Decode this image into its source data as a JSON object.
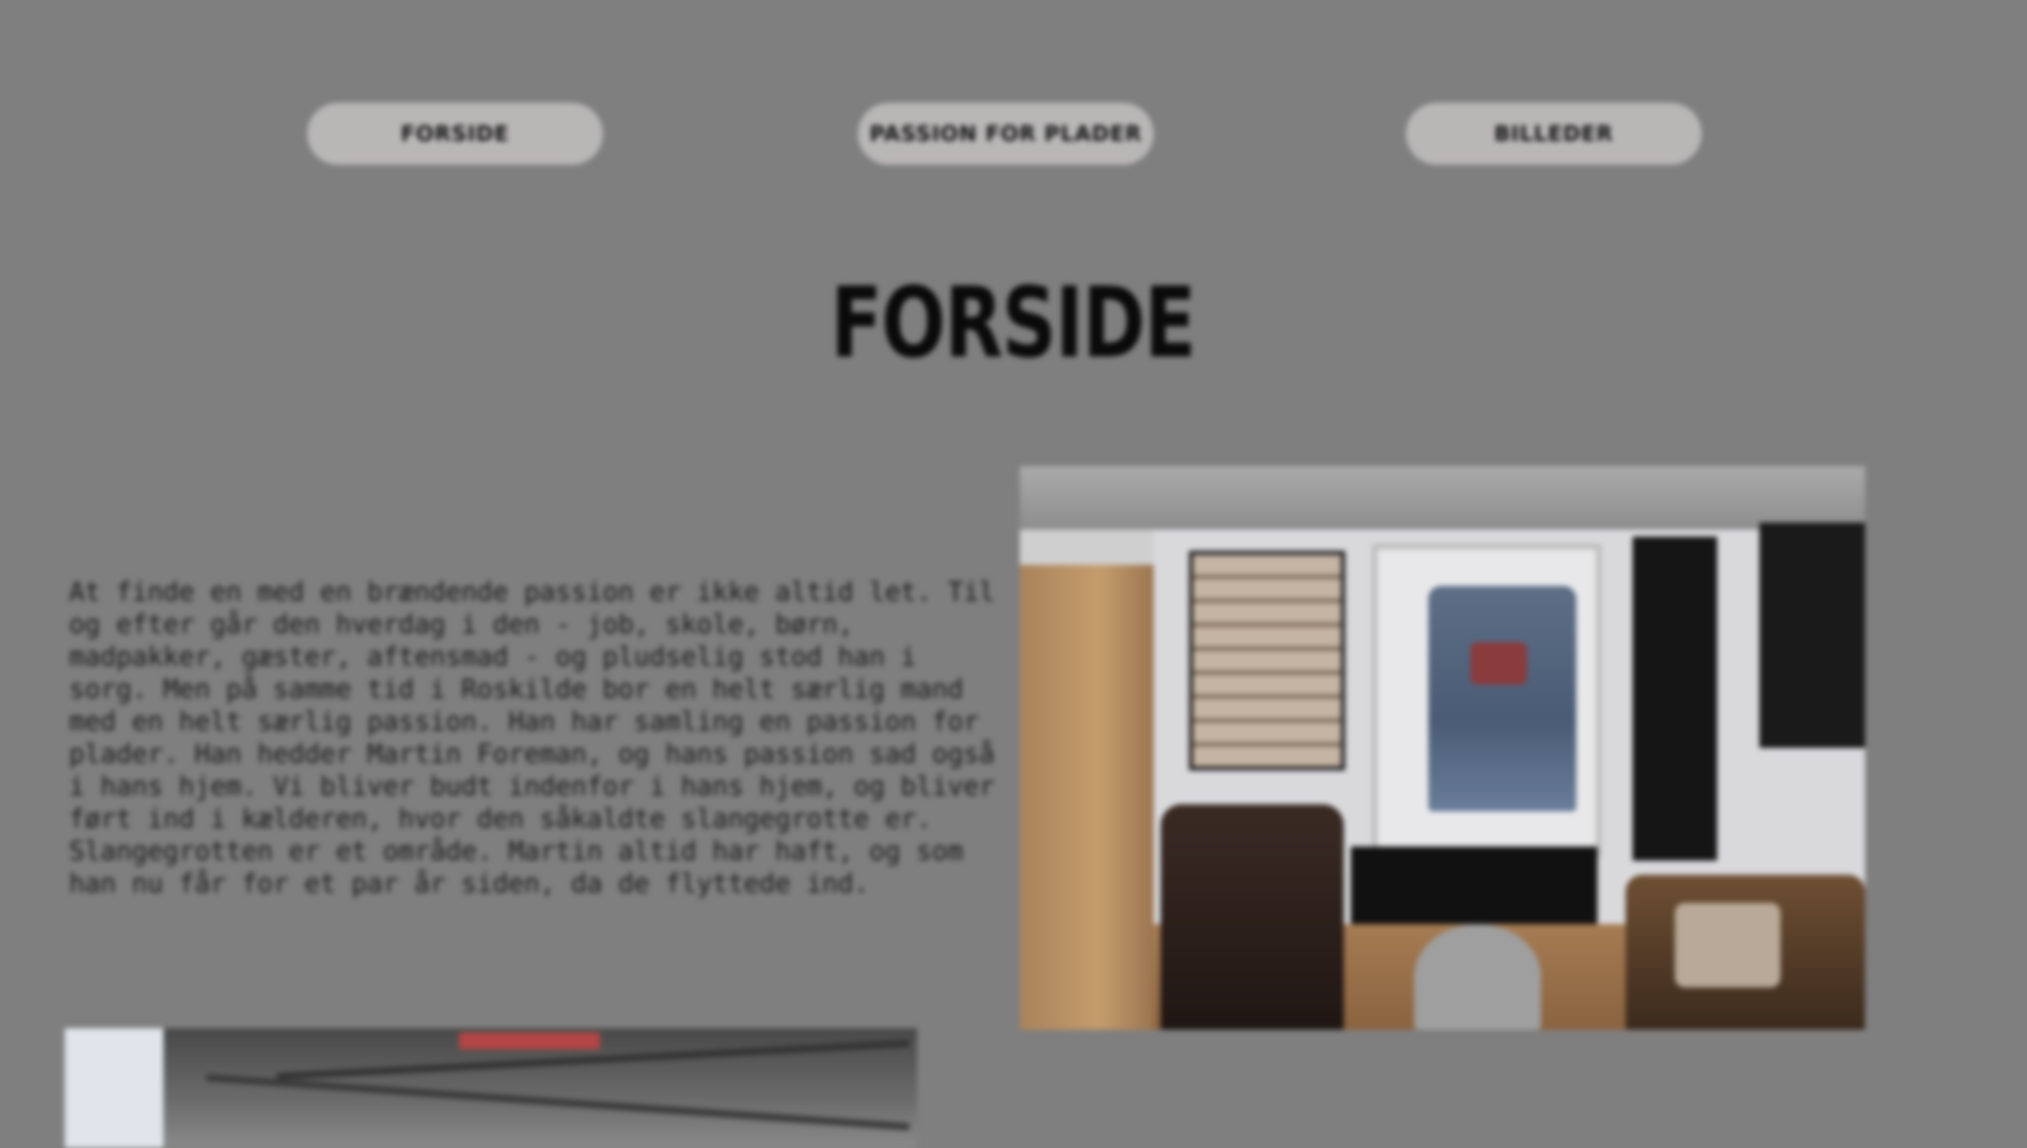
{
  "nav": {
    "items": [
      {
        "label": "FORSIDE"
      },
      {
        "label": "PASSION FOR PLADER"
      },
      {
        "label": "BILLEDER"
      }
    ]
  },
  "page_title": "FORSIDE",
  "intro_text": "At finde en med en brændende passion er ikke altid let. Til og efter går den hverdag i den - job, skole, børn, madpakker, gæster, aftensmad - og pludselig stod han i sorg. Men på samme tid i Roskilde bor en helt særlig mand med en helt særlig passion. Han har samling en passion for plader. Han hedder Martin Foreman, og hans passion sad også i hans hjem. Vi bliver budt indenfor i hans hjem, og bliver ført ind i kælderen, hvor den såkaldte slangegrotte er. Slangegrotten er et område. Martin altid har haft, og som han nu får for et par år siden, da de flyttede ind.",
  "images": {
    "room_photo": {
      "alt": "room with vest on wall"
    },
    "tent_photo": {
      "alt": "tent roof"
    }
  }
}
